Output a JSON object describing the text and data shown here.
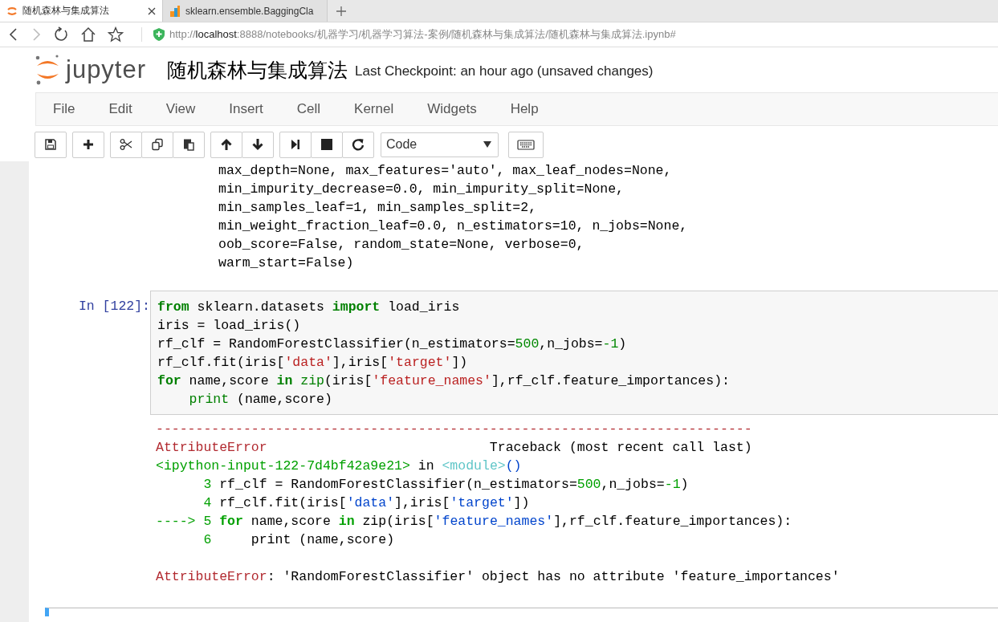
{
  "browser": {
    "tabs": [
      {
        "title": "随机森林与集成算法",
        "kind": "jupyter",
        "selected": true
      },
      {
        "title": "sklearn.ensemble.BaggingCla",
        "kind": "sklearn",
        "selected": false
      }
    ],
    "url": "http://**localhost**:8888/notebooks/机器学习/机器学习算法-案例/随机森林与集成算法/随机森林与集成算法.ipynb#"
  },
  "header": {
    "logo_text": "jupyter",
    "notebook_title": "随机森林与集成算法",
    "checkpoint": "Last Checkpoint: an hour ago (unsaved changes)"
  },
  "menu": [
    "File",
    "Edit",
    "View",
    "Insert",
    "Cell",
    "Kernel",
    "Widgets",
    "Help"
  ],
  "toolbar": [
    [
      {
        "kind": "save"
      }
    ],
    [
      {
        "kind": "add"
      }
    ],
    [
      {
        "kind": "cut"
      },
      {
        "kind": "copy"
      },
      {
        "kind": "paste"
      }
    ],
    [
      {
        "kind": "up"
      },
      {
        "kind": "down"
      }
    ],
    [
      {
        "kind": "run"
      },
      {
        "kind": "stop"
      },
      {
        "kind": "restart"
      }
    ],
    [
      {
        "kind": "select",
        "value": "Code"
      }
    ],
    [
      {
        "kind": "keyboard"
      }
    ]
  ],
  "previous_output": [
    "max_depth=None, max_features='auto', max_leaf_nodes=None,",
    "min_impurity_decrease=0.0, min_impurity_split=None,",
    "min_samples_leaf=1, min_samples_split=2,",
    "min_weight_fraction_leaf=0.0, n_estimators=10, n_jobs=None,",
    "oob_score=False, random_state=None, verbose=0,",
    "warm_start=False)"
  ],
  "cell": {
    "prompt": "In [122]:",
    "code": [
      [
        {
          "t": "from",
          "kind": "kw"
        },
        {
          "t": " sklearn.datasets ",
          "kind": "plain"
        },
        {
          "t": "import",
          "kind": "kw"
        },
        {
          "t": " load_iris",
          "kind": "plain"
        }
      ],
      [
        {
          "t": "iris = load_iris()",
          "kind": "plain"
        }
      ],
      [
        {
          "t": "rf_clf = RandomForestClassifier(n_estimators=",
          "kind": "plain"
        },
        {
          "t": "500",
          "kind": "num"
        },
        {
          "t": ",n_jobs=",
          "kind": "plain"
        },
        {
          "t": "-1",
          "kind": "num"
        },
        {
          "t": ")",
          "kind": "plain"
        }
      ],
      [
        {
          "t": "rf_clf.fit(iris[",
          "kind": "plain"
        },
        {
          "t": "'data'",
          "kind": "str"
        },
        {
          "t": "],iris[",
          "kind": "plain"
        },
        {
          "t": "'target'",
          "kind": "str"
        },
        {
          "t": "])",
          "kind": "plain"
        }
      ],
      [
        {
          "t": "for",
          "kind": "kw"
        },
        {
          "t": " name,score ",
          "kind": "plain"
        },
        {
          "t": "in",
          "kind": "kw"
        },
        {
          "t": " zip",
          "kind": "builtin"
        },
        {
          "t": "(iris[",
          "kind": "plain"
        },
        {
          "t": "'feature_names'",
          "kind": "str"
        },
        {
          "t": "],rf_clf.feature_importances):",
          "kind": "plain"
        }
      ],
      [
        {
          "t": "    print",
          "kind": "builtin"
        },
        {
          "t": " (name,score)",
          "kind": "plain"
        }
      ]
    ],
    "traceback": [
      [
        {
          "t": "---------------------------------------------------------------------------",
          "kind": "err"
        }
      ],
      [
        {
          "t": "AttributeError",
          "kind": "err"
        },
        {
          "t": "                            Traceback (most recent call last)",
          "kind": "plain"
        }
      ],
      [
        {
          "t": "<ipython-input-122-7d4bf42a9e21>",
          "kind": "tbgreen"
        },
        {
          "t": " in ",
          "kind": "plain"
        },
        {
          "t": "<module>",
          "kind": "module"
        },
        {
          "t": "()",
          "kind": "tbblue"
        }
      ],
      [
        {
          "t": "      3",
          "kind": "tbgreen"
        },
        {
          "t": " rf_clf = RandomForestClassifier(n_estimators=",
          "kind": "plain"
        },
        {
          "t": "500",
          "kind": "tbgreen"
        },
        {
          "t": ",n_jobs=",
          "kind": "plain"
        },
        {
          "t": "-1",
          "kind": "tbgreen"
        },
        {
          "t": ")",
          "kind": "plain"
        }
      ],
      [
        {
          "t": "      4",
          "kind": "tbgreen"
        },
        {
          "t": " rf_clf.fit(iris[",
          "kind": "plain"
        },
        {
          "t": "'data'",
          "kind": "tbblue"
        },
        {
          "t": "],iris[",
          "kind": "plain"
        },
        {
          "t": "'target'",
          "kind": "tbblue"
        },
        {
          "t": "])",
          "kind": "plain"
        }
      ],
      [
        {
          "t": "----> 5",
          "kind": "tbgreen"
        },
        {
          "t": " for",
          "kind": "tbkw"
        },
        {
          "t": " name,score ",
          "kind": "plain"
        },
        {
          "t": "in",
          "kind": "tbkw"
        },
        {
          "t": " zip(iris[",
          "kind": "plain"
        },
        {
          "t": "'feature_names'",
          "kind": "tbblue"
        },
        {
          "t": "],rf_clf.feature_importances):",
          "kind": "plain"
        }
      ],
      [
        {
          "t": "      6",
          "kind": "tbgreen"
        },
        {
          "t": "     print (name,score)",
          "kind": "plain"
        }
      ]
    ],
    "error_message": [
      {
        "t": "AttributeError",
        "kind": "err"
      },
      {
        "t": ": 'RandomForestClassifier' object has no attribute 'feature_importances'",
        "kind": "plain"
      }
    ]
  },
  "next_cell": {
    "selected": true
  }
}
